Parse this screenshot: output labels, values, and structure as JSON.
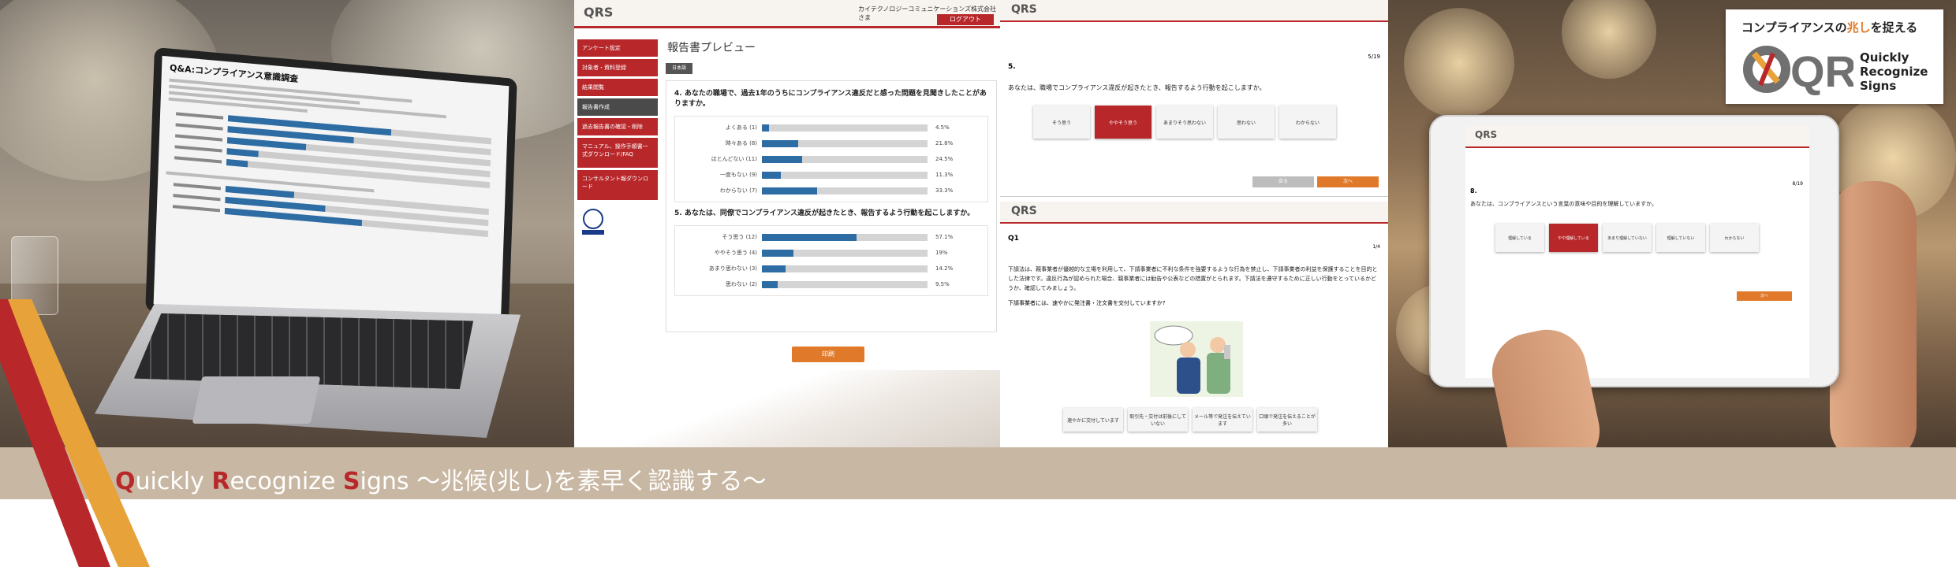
{
  "panel_report_laptop": {
    "title": "Q&A:コンプライアンス意識調査",
    "rows": [
      0.62,
      0.48,
      0.3,
      0.12,
      0.08
    ],
    "rows2": [
      0.26,
      0.38,
      0.52
    ]
  },
  "panel_report": {
    "company": "カイテクノロジーコミュニケーションズ株式会社 さま",
    "logout": "ログアウト",
    "logo": "QRS",
    "nav": [
      "アンケート設定",
      "対象者・資料登録",
      "結果閲覧",
      "報告書作成",
      "過去報告書の確認・削除",
      "マニュアル、操作手順書一式ダウンロード/FAQ",
      "コンサルタント報ダウンロード"
    ],
    "page_title": "報告書プレビュー",
    "lang_button": "日本語",
    "questions": [
      {
        "title": "4. あなたの職場で、過去1年のうちにコンプライアンス違反だと感った問題を見聞きしたことがありますか。",
        "options": [
          {
            "label": "よくある (1)",
            "pct": "4.5%",
            "value": 0.045
          },
          {
            "label": "時々ある (8)",
            "pct": "21.8%",
            "value": 0.218
          },
          {
            "label": "ほとんどない (11)",
            "pct": "24.5%",
            "value": 0.245
          },
          {
            "label": "一度もない (9)",
            "pct": "11.3%",
            "value": 0.113
          },
          {
            "label": "わからない (7)",
            "pct": "33.3%",
            "value": 0.333
          }
        ]
      },
      {
        "title": "5. あなたは、同僚でコンプライアンス違反が起きたとき、報告するよう行動を起こしますか。",
        "options": [
          {
            "label": "そう思う (12)",
            "pct": "57.1%",
            "value": 0.571
          },
          {
            "label": "ややそう思う (4)",
            "pct": "19%",
            "value": 0.19
          },
          {
            "label": "あまり思わない (3)",
            "pct": "14.2%",
            "value": 0.142
          },
          {
            "label": "思わない (2)",
            "pct": "9.5%",
            "value": 0.095
          }
        ]
      }
    ],
    "print_button": "印刷"
  },
  "panel_survey_top": {
    "logo": "QRS",
    "question_number": "5.",
    "page": "5/19",
    "question": "あなたは、職場でコンプライアンス違反が起きたとき、報告するよう行動を起こしますか。",
    "options": [
      "そう思う",
      "ややそう思う",
      "あまりそう思わない",
      "思わない",
      "わからない"
    ],
    "selected_index": 1,
    "back_button": "戻る",
    "next_button": "次へ"
  },
  "panel_survey_bottom": {
    "logo": "QRS",
    "question_number": "Q1",
    "page": "1/4",
    "text": "下請法は、親事業者が優越的な立場を利用して、下請事業者に不利な条件を強要するような行為を禁止し、下請事業者の利益を保護することを目的とした法律です。違反行為が認められた場合、親事業者には勧告や公表などの措置がとられます。下請法を遵守するために正しい行動をとっているかどうか、確認してみましょう。",
    "question": "下請事業者には、速やかに発注書・注文書を交付していますか?",
    "options": [
      "速やかに交付しています",
      "取引先・交付は前後にしていない",
      "メール等で発注を伝えています",
      "口頭で発注を伝えることが多い"
    ]
  },
  "panel_tablet": {
    "logo": "QRS",
    "question_number": "8.",
    "page": "8/19",
    "question": "あなたは、コンプライアンスという言葉の意味や目的を理解していますか。",
    "options": [
      "理解している",
      "やや理解している",
      "あまり理解していない",
      "理解していない",
      "わからない"
    ],
    "selected_index": 1,
    "next_button": "次へ"
  },
  "logo": {
    "tagline_pre": "コンプライアンスの",
    "tagline_em": "兆し",
    "tagline_post": "を捉える",
    "mark": "QRS",
    "sub1": "Quickly",
    "sub2": "Recognize",
    "sub3": "Signs"
  },
  "band": {
    "q": "Q",
    "uickly": "uickly ",
    "r": "R",
    "ecognize": "ecognize ",
    "s": "S",
    "igns": "igns",
    "jp": " ～兆候(兆し)を素早く認識する～"
  },
  "colors": {
    "brand_red": "#b8282b",
    "accent_orange": "#e07a2a",
    "band_beige": "#c8b7a2",
    "bar_blue": "#2e6da4"
  }
}
